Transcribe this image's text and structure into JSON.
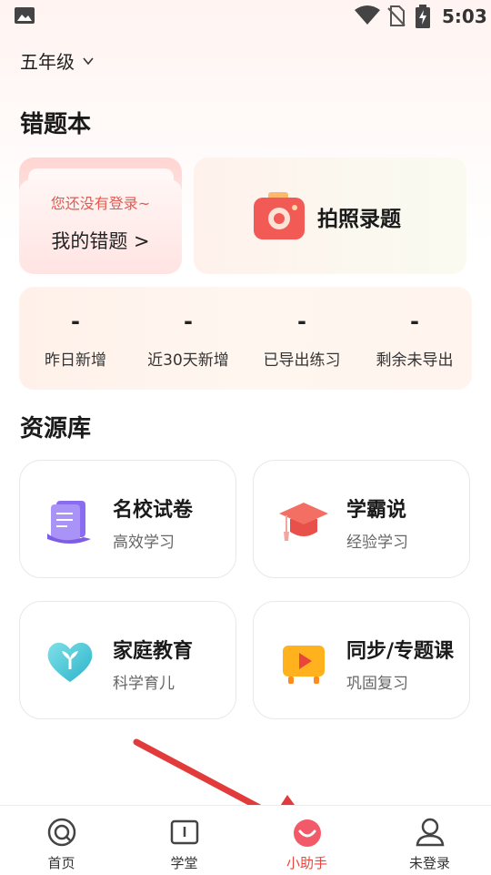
{
  "status_bar": {
    "time": "5:03",
    "icons": [
      "image-icon",
      "wifi-icon",
      "no-sim-icon",
      "battery-charging-icon"
    ]
  },
  "grade": {
    "label": "五年级",
    "icon": "chevron-down-icon"
  },
  "mistakes_section": {
    "title": "错题本",
    "mistakes_card": {
      "hint": "您还没有登录~",
      "label": "我的错题 >"
    },
    "photo_card": {
      "label": "拍照录题",
      "icon": "camera-icon"
    },
    "stats": [
      {
        "value": "-",
        "label": "昨日新增"
      },
      {
        "value": "-",
        "label": "近30天新增"
      },
      {
        "value": "-",
        "label": "已导出练习"
      },
      {
        "value": "-",
        "label": "剩余未导出"
      }
    ]
  },
  "resources_section": {
    "title": "资源库",
    "items": [
      {
        "title": "名校试卷",
        "subtitle": "高效学习",
        "icon": "exam-paper-icon"
      },
      {
        "title": "学霸说",
        "subtitle": "经验学习",
        "icon": "graduation-cap-icon"
      },
      {
        "title": "家庭教育",
        "subtitle": "科学育儿",
        "icon": "heart-sprout-icon"
      },
      {
        "title": "同步/专题课",
        "subtitle": "巩固复习",
        "icon": "video-play-icon"
      }
    ]
  },
  "tab_bar": {
    "tabs": [
      {
        "label": "首页",
        "icon": "home-icon",
        "active": false
      },
      {
        "label": "学堂",
        "icon": "book-icon",
        "active": false
      },
      {
        "label": "小助手",
        "icon": "assistant-icon",
        "active": true
      },
      {
        "label": "未登录",
        "icon": "user-icon",
        "active": false
      }
    ]
  },
  "colors": {
    "accent": "#e8453c",
    "hint_text": "#e35a4f",
    "annotation_arrow": "#e23b3b"
  }
}
